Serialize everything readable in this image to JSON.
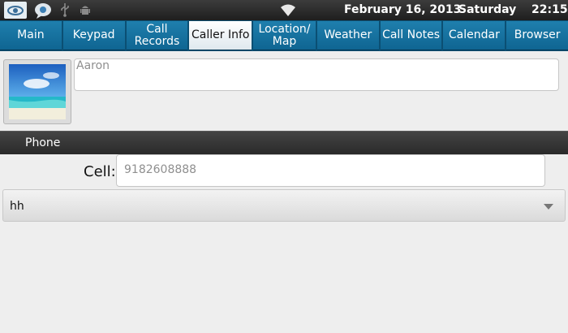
{
  "status_bar": {
    "date": "February 16, 2013",
    "day": "Saturday",
    "time": "22:15",
    "icons": [
      "app-logo-icon",
      "chat-bubble-icon",
      "usb-icon",
      "android-icon",
      "wifi-icon"
    ]
  },
  "tabs": [
    {
      "label": "Main",
      "active": false
    },
    {
      "label": "Keypad",
      "active": false
    },
    {
      "label": "Call\nRecords",
      "active": false
    },
    {
      "label": "Caller Info",
      "active": true
    },
    {
      "label": "Location/\nMap",
      "active": false
    },
    {
      "label": "Weather",
      "active": false
    },
    {
      "label": "Call Notes",
      "active": false
    },
    {
      "label": "Calendar",
      "active": false
    },
    {
      "label": "Browser",
      "active": false
    }
  ],
  "contact": {
    "name_value": "Aaron"
  },
  "phone_section": {
    "title": "Phone",
    "cell_label": "Cell:",
    "cell_value": "9182608888",
    "spinner_value": "hh"
  }
}
